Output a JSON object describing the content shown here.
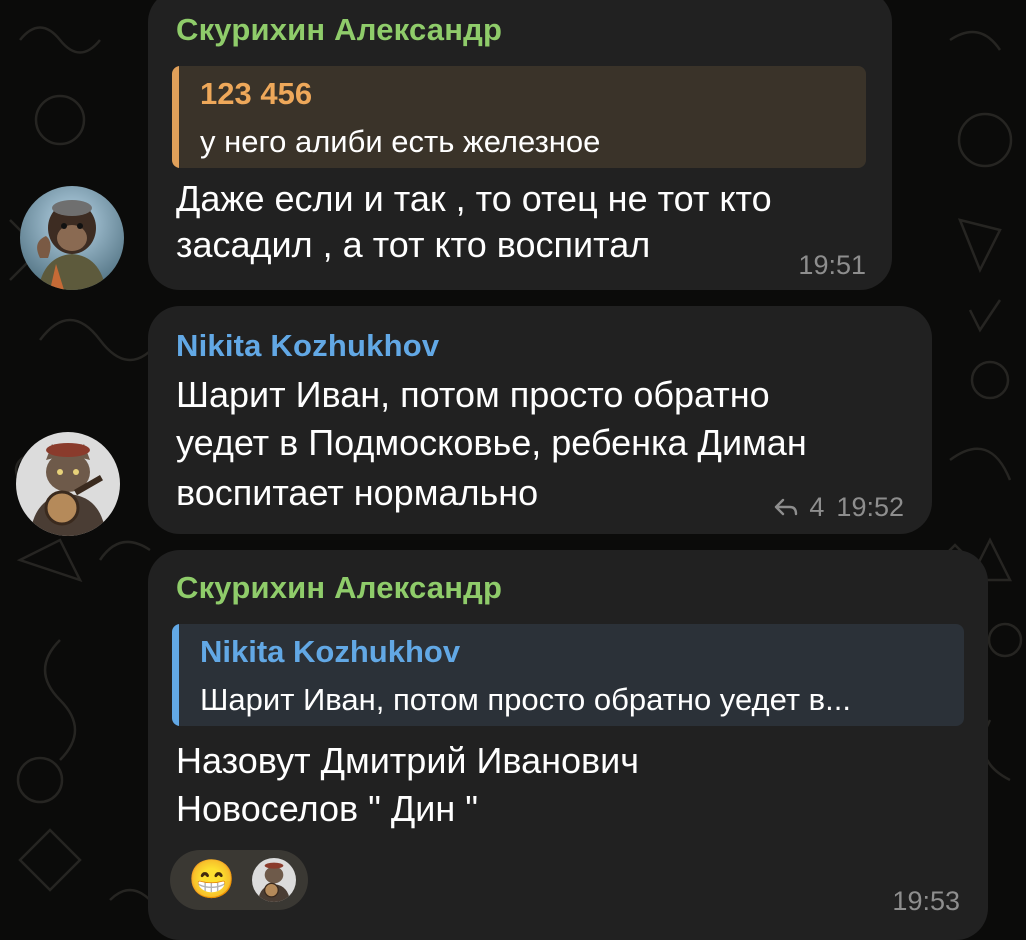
{
  "colors": {
    "background": "#0b0b0a",
    "bubble": "#212121",
    "sender_green": "#8fcc6a",
    "sender_blue": "#62a8e5",
    "quote_orange_bar": "#e0a05a",
    "quote_orange_bg": "#3a3329",
    "quote_orange_title": "#eea85a",
    "quote_blue_bar": "#62a8e5",
    "quote_blue_bg": "#2b3138",
    "time_gray": "#8e8e8e"
  },
  "messages": [
    {
      "sender": "Скурихин Александр",
      "quote": {
        "title": "123 456",
        "text": "у него алиби есть железное"
      },
      "line1": "Даже если и так , то отец не тот кто",
      "line2": "засадил , а тот кто воспитал",
      "time": "19:51",
      "avatar_icon": "chimpanzee-avatar-icon"
    },
    {
      "sender": "Nikita Kozhukhov",
      "line1": "Шарит Иван, потом просто обратно",
      "line2": "уедет в Подмосковье, ребенка Диман",
      "line3": "воспитает нормально",
      "reply_count": "4",
      "time": "19:52",
      "avatar_icon": "cat-with-banjo-avatar-icon"
    },
    {
      "sender": "Скурихин Александр",
      "quote": {
        "title": "Nikita Kozhukhov",
        "text": "Шарит Иван, потом просто обратно уедет в..."
      },
      "line1": "Назовут Дмитрий Иванович",
      "line2": "Новоселов \" Дин \"",
      "reaction": {
        "emoji": "😁",
        "reactor_icon": "cat-with-banjo-avatar-icon"
      },
      "time": "19:53"
    }
  ]
}
